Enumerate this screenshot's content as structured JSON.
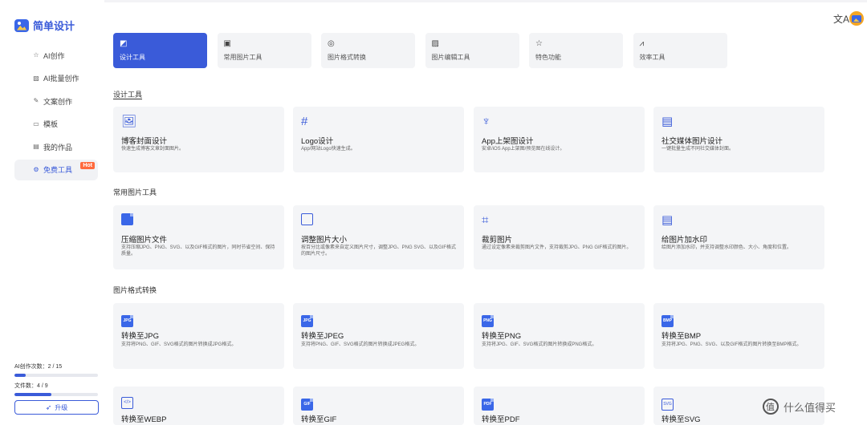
{
  "app": {
    "name": "简单设计"
  },
  "sidebar": {
    "items": [
      {
        "label": "AI创作",
        "icon": "star-icon"
      },
      {
        "label": "AI批量创作",
        "icon": "image-batch-icon"
      },
      {
        "label": "文案创作",
        "icon": "edit-icon"
      },
      {
        "label": "模板",
        "icon": "template-icon"
      },
      {
        "label": "我的作品",
        "icon": "folder-icon"
      },
      {
        "label": "免费工具",
        "icon": "gear-icon",
        "badge": "Hot",
        "active": true
      }
    ],
    "usage": [
      {
        "label": "AI创作次数：2 / 15",
        "fraction": 0.133
      },
      {
        "label": "文件数：4 / 9",
        "fraction": 0.444
      }
    ],
    "upgrade_label": "升级"
  },
  "tabs": [
    {
      "label": "设计工具",
      "active": true
    },
    {
      "label": "常用图片工具"
    },
    {
      "label": "图片格式转换"
    },
    {
      "label": "图片编辑工具"
    },
    {
      "label": "特色功能"
    },
    {
      "label": "效率工具"
    }
  ],
  "sections": {
    "design": {
      "title": "设计工具",
      "cards": [
        {
          "title": "博客封面设计",
          "desc": "快速生成博客文章封面图片。"
        },
        {
          "title": "Logo设计",
          "desc": "App/网站Logo快速生成。"
        },
        {
          "title": "App上架图设计",
          "desc": "安卓/iOS App上架图/预览图在线设计。"
        },
        {
          "title": "社交媒体图片设计",
          "desc": "一键批量生成不同社交媒体封面。"
        }
      ]
    },
    "common": {
      "title": "常用图片工具",
      "cards": [
        {
          "title": "压缩图片文件",
          "desc": "支持压缩JPG、PNG、SVG、以及GIF格式的图片，同时节省空间、保持质量。"
        },
        {
          "title": "调整图片大小",
          "desc": "按百分比或像素来自定义图片尺寸，调整JPG、PNG SVG、以及GIF格式的图片尺寸。"
        },
        {
          "title": "裁剪图片",
          "desc": "通过设定像素来裁剪图片文件，支持裁剪JPG、PNG GIF格式的图片。"
        },
        {
          "title": "给图片加水印",
          "desc": "给图片添加水印，并支持调整水印颜色、大小、角度和位置。"
        }
      ]
    },
    "convert": {
      "title": "图片格式转换",
      "cards": [
        {
          "title": "转换至JPG",
          "desc": "支持将PNG、GIF、SVG格式的图片转换成JPG格式。",
          "tag": "JPG"
        },
        {
          "title": "转换至JPEG",
          "desc": "支持将PNG、GIF、SVG格式的图片转换成JPEG格式。",
          "tag": "JPG"
        },
        {
          "title": "转换至PNG",
          "desc": "支持将JPG、GIF、SVG格式的图片转换成PNG格式。",
          "tag": "PNG"
        },
        {
          "title": "转换至BMP",
          "desc": "支持将JPG、PNG、SVG、以及GIF格式的图片转换至BMP格式。",
          "tag": "BMP"
        }
      ],
      "more_cards": [
        {
          "title": "转换至WEBP",
          "tag": "</>"
        },
        {
          "title": "转换至GIF",
          "tag": "GIF"
        },
        {
          "title": "转换至PDF",
          "tag": "PDF"
        },
        {
          "title": "转换至SVG",
          "tag": "SVG"
        }
      ]
    }
  },
  "header": {
    "translate_icon": "文A"
  },
  "watermark": {
    "text": "什么值得买"
  },
  "colors": {
    "accent": "#3a5bd9",
    "card_bg": "#f4f5f7",
    "hot": "#ff6a3d"
  }
}
